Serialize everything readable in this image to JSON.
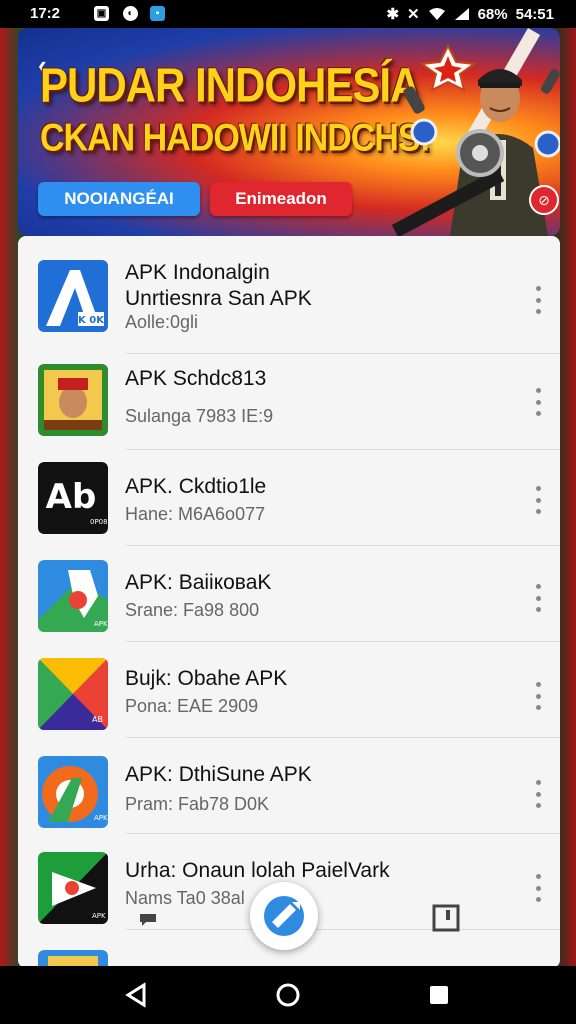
{
  "status_bar": {
    "time": "17:2",
    "battery": "68%",
    "clock_right": "54:51",
    "icons": [
      "photo-icon",
      "circle-icon",
      "app-icon",
      "bluetooth-icon",
      "mute-icon",
      "wifi-icon",
      "signal-icon"
    ]
  },
  "banner": {
    "headline": "PUDAR INDOHESÍA",
    "subheadline": "CKAN HADOWII INDCHS!",
    "button_primary": "NOOIANGÉAI",
    "button_secondary": "Enimeadon",
    "colors": {
      "headline": "#ffd21a",
      "primary": "#2f8ff0",
      "secondary": "#e0262e"
    }
  },
  "apps": [
    {
      "title": "APK Indonalgin\nUnrtiesnra San APK",
      "subtitle": "Aolle:0gli",
      "icon": "blue-a-icon"
    },
    {
      "title": "APK Schdc813",
      "subtitle": "Sulanga 7983 IE:9",
      "icon": "soldier-portrait-icon"
    },
    {
      "title": "APK. Ckdtio1le",
      "subtitle": "Hane: M6A6o077",
      "icon": "ab-logo-icon"
    },
    {
      "title": "APK: BaiiковаK",
      "subtitle": "Srane: Fa98 800",
      "icon": "map-pin-icon"
    },
    {
      "title": "Bujk: Obahe APK",
      "subtitle": "Pona: EAE 2909",
      "icon": "triangle-drive-icon"
    },
    {
      "title": "APK: DthiSune APK",
      "subtitle": "Pram: Fab78 D0K",
      "icon": "orange-a-icon"
    },
    {
      "title": "Urha: Onaun lolah PaielVark",
      "subtitle": "Nams Ta0 38al",
      "icon": "green-arrow-icon"
    },
    {
      "title": "",
      "subtitle": "",
      "icon": "blue-partial-icon"
    }
  ],
  "fab": {
    "icon": "refresh-icon"
  },
  "bottom_nav": [
    "back-icon",
    "home-icon",
    "recents-icon"
  ]
}
